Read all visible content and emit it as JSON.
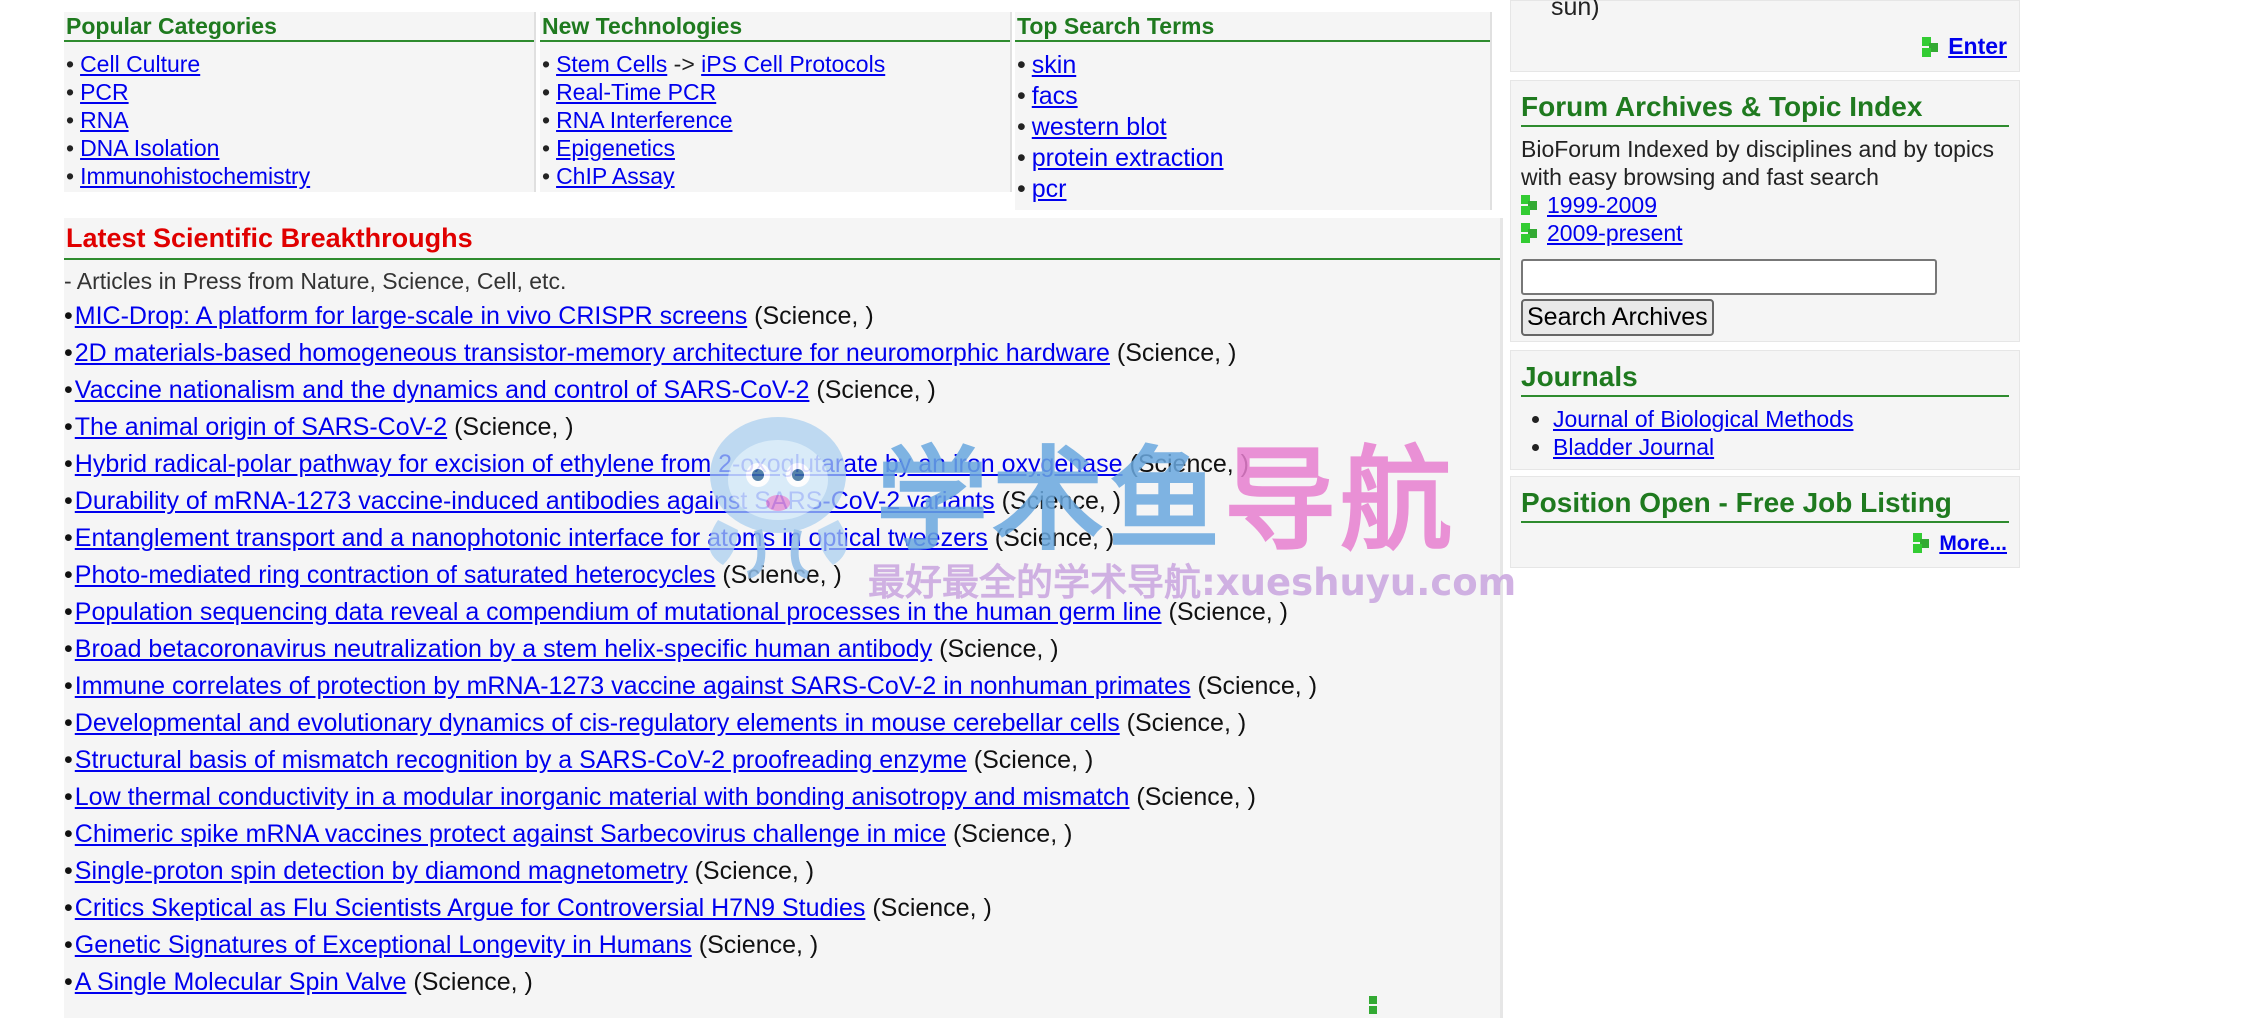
{
  "popular": {
    "title": "Popular Categories",
    "items": [
      "Cell Culture",
      "PCR",
      "RNA",
      "DNA Isolation",
      "Immunohistochemistry"
    ]
  },
  "newtech": {
    "title": "New Technologies",
    "items": [
      {
        "a": "Stem Cells",
        "sep": " -> ",
        "b": "iPS Cell Protocols"
      },
      {
        "a": "Real-Time PCR"
      },
      {
        "a": "RNA Interference"
      },
      {
        "a": "Epigenetics"
      },
      {
        "a": "ChIP Assay"
      }
    ]
  },
  "topsearch": {
    "title": "Top Search Terms",
    "items": [
      "skin",
      "facs",
      "western blot",
      "protein extraction",
      "pcr"
    ]
  },
  "latest": {
    "title": "Latest Scientific Breakthroughs",
    "subtitle": "- Articles in Press from Nature, Science, Cell, etc.",
    "bullet": "•",
    "articles": [
      {
        "title": "MIC-Drop: A platform for large-scale in vivo CRISPR screens",
        "source": "(Science, )"
      },
      {
        "title": "2D materials-based homogeneous transistor-memory architecture for neuromorphic hardware",
        "source": "(Science, )"
      },
      {
        "title": "Vaccine nationalism and the dynamics and control of SARS-CoV-2",
        "source": "(Science, )"
      },
      {
        "title": "The animal origin of SARS-CoV-2",
        "source": "(Science, )"
      },
      {
        "title": "Hybrid radical-polar pathway for excision of ethylene from 2-oxoglutarate by an iron oxygenase",
        "source": "(Science, )"
      },
      {
        "title": "Durability of mRNA-1273 vaccine-induced antibodies against SARS-CoV-2 variants",
        "source": "(Science, )"
      },
      {
        "title": "Entanglement transport and a nanophotonic interface for atoms in optical tweezers",
        "source": "(Science, )"
      },
      {
        "title": "Photo-mediated ring contraction of saturated heterocycles",
        "source": "(Science, )"
      },
      {
        "title": "Population sequencing data reveal a compendium of mutational processes in the human germ line",
        "source": "(Science, )"
      },
      {
        "title": "Broad betacoronavirus neutralization by a stem helix-specific human antibody",
        "source": "(Science, )"
      },
      {
        "title": "Immune correlates of protection by mRNA-1273 vaccine against SARS-CoV-2 in nonhuman primates",
        "source": "(Science, )"
      },
      {
        "title": "Developmental and evolutionary dynamics of cis-regulatory elements in mouse cerebellar cells",
        "source": "(Science, )"
      },
      {
        "title": "Structural basis of mismatch recognition by a SARS-CoV-2 proofreading enzyme",
        "source": "(Science, )"
      },
      {
        "title": "Low thermal conductivity in a modular inorganic material with bonding anisotropy and mismatch",
        "source": "(Science, )"
      },
      {
        "title": "Chimeric spike mRNA vaccines protect against Sarbecovirus challenge in mice",
        "source": "(Science, )"
      },
      {
        "title": "Single-proton spin detection by diamond magnetometry",
        "source": "(Science, )"
      },
      {
        "title": "Critics Skeptical as Flu Scientists Argue for Controversial H7N9 Studies",
        "source": "(Science, )"
      },
      {
        "title": "Genetic Signatures of Exceptional Longevity in Humans",
        "source": "(Science, )"
      },
      {
        "title": "A Single Molecular Spin Valve",
        "source": "(Science, )"
      }
    ]
  },
  "side": {
    "top_text": "sun)",
    "enter_label": "Enter",
    "forum_title": "Forum Archives & Topic Index",
    "forum_desc": "BioForum Indexed by disciplines and by topics with easy browsing and fast search",
    "years": [
      "1999-2009",
      "2009-present"
    ],
    "search_value": "",
    "search_button": "Search Archives",
    "journals_title": "Journals",
    "journals": [
      "Journal of Biological Methods",
      "Bladder Journal"
    ],
    "jobs_title": "Position Open - Free Job Listing",
    "more_label": "More..."
  },
  "watermark": {
    "main_a": "学术鱼",
    "main_b": "导航",
    "sub": "最好最全的学术导航:xueshuyu.com"
  },
  "colors": {
    "green": "#1f7a1f",
    "red": "#e00000",
    "link": "#0000ee",
    "icon_green": "#33aa33"
  }
}
